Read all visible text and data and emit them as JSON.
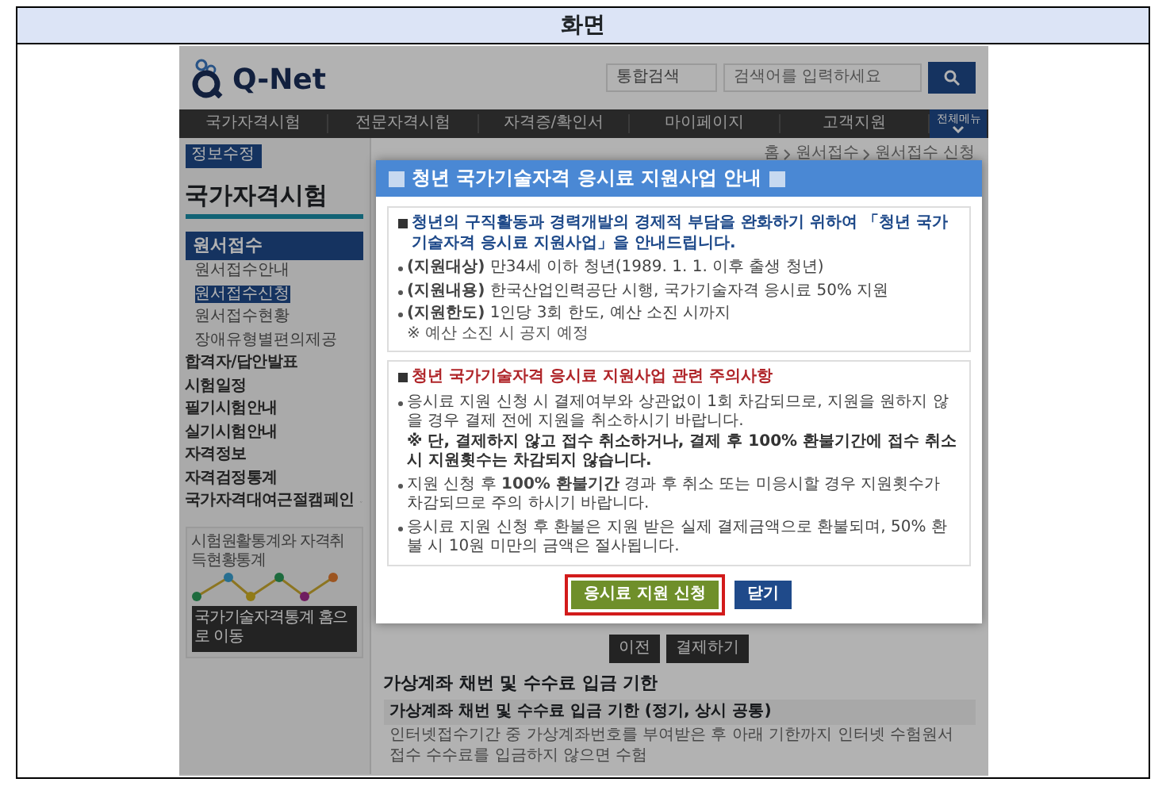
{
  "document": {
    "header": "화면"
  },
  "site": {
    "logo_text": "Q-Net",
    "search": {
      "scope": "통합검색",
      "placeholder": "검색어를 입력하세요"
    },
    "nav": [
      {
        "label": "국가자격시험"
      },
      {
        "label": "전문자격시험"
      },
      {
        "label": "자격증/확인서"
      },
      {
        "label": "마이페이지"
      },
      {
        "label": "고객지원"
      }
    ],
    "all_menu": "전체메뉴"
  },
  "sidebar": {
    "user_button": "정보수정",
    "title": "국가자격시험",
    "section": "원서접수",
    "links": [
      {
        "label": "원서접수안내",
        "selected": false
      },
      {
        "label": "원서접수신청",
        "selected": true
      },
      {
        "label": "원서접수현황",
        "selected": false
      },
      {
        "label": "장애유형별편의제공",
        "selected": false
      }
    ],
    "menu": [
      {
        "label": "합격자/답안발표",
        "expandable": false
      },
      {
        "label": "시험일정",
        "expandable": false
      },
      {
        "label": "필기시험안내",
        "expandable": false
      },
      {
        "label": "실기시험안내",
        "expandable": false
      },
      {
        "label": "자격정보",
        "expandable": false
      },
      {
        "label": "자격검정통계",
        "expandable": false
      },
      {
        "label": "국가자격대여근절캠페인",
        "expandable": true
      }
    ],
    "widget": {
      "caption": "시험원활통계와 자격취득현황통계",
      "link": "국가기술자격통계 홈으로 이동"
    }
  },
  "breadcrumb": [
    "홈",
    "원서접수",
    "원서접수 신청"
  ],
  "content": {
    "buttons": [
      "이전",
      "결제하기"
    ],
    "heading": "가상계좌 채번 및 수수료 입금 기한",
    "subheading": "가상계좌 채번 및 수수료 입금 기한 (정기, 상시 공통)",
    "line": "인터넷접수기간 중 가상계좌번호를 부여받은 후 아래 기한까지 인터넷 수험원서 접수 수수료를 입금하지 않으면 수험"
  },
  "modal": {
    "title": "청년 국가기술자격 응시료 지원사업 안내",
    "sections": [
      {
        "kind": "info",
        "heading": "청년의 구직활동과 경력개발의 경제적 부담을 완화하기 위하여 「청년 국가기술자격 응시료 지원사업」을 안내드립니다.",
        "items": [
          {
            "text": "**(지원대상)** 만34세 이하 청년(1989. 1. 1. 이후 출생 청년)"
          },
          {
            "text": "**(지원내용)** 한국산업인력공단 시행, 국가기술자격 응시료 50% 지원"
          },
          {
            "text": "**(지원한도)** 1인당 3회 한도, 예산 소진 시까지",
            "note": {
              "text": "※ 예산 소진 시 공지 예정",
              "bold": false
            }
          }
        ]
      },
      {
        "kind": "warning",
        "heading": "청년 국가기술자격 응시료 지원사업 관련 주의사항",
        "items": [
          {
            "text": "응시료 지원 신청 시 결제여부와 상관없이 1회 차감되므로, 지원을 원하지 않을 경우 결제 전에 지원을 취소하시기 바랍니다.",
            "note": {
              "text": "※ 단, 결제하지 않고 접수 취소하거나, 결제 후 100% 환불기간에 접수 취소 시 지원횟수는 차감되지 않습니다.",
              "bold": true
            }
          },
          {
            "text": "지원 신청 후 **100% 환불기간** 경과 후 취소 또는 미응시할 경우 지원횟수가 차감되므로 주의 하시기 바랍니다."
          },
          {
            "text": "응시료 지원 신청 후 환불은 지원 받은 실제 결제금액으로 환불되며, 50% 환불 시 10원 미만의 금액은 절사됩니다."
          }
        ]
      }
    ],
    "buttons": [
      {
        "label": "응시료 지원 신청",
        "kind": "apply",
        "highlighted": true
      },
      {
        "label": "닫기",
        "kind": "close",
        "highlighted": false
      }
    ]
  }
}
